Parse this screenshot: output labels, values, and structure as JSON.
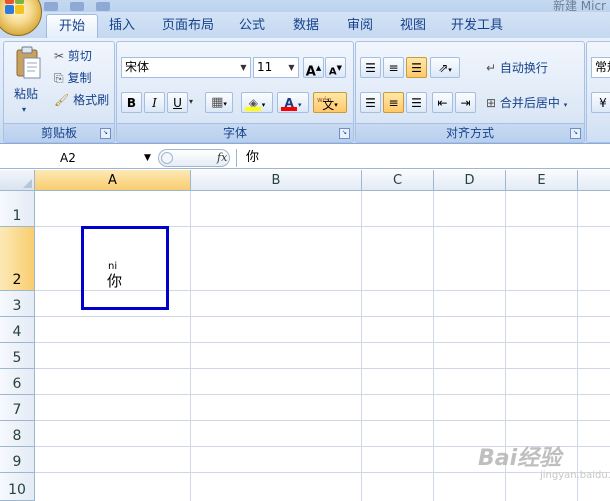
{
  "window": {
    "title_fragment": "新建 Micr"
  },
  "tabs": [
    {
      "label": "开始",
      "active": true
    },
    {
      "label": "插入"
    },
    {
      "label": "页面布局"
    },
    {
      "label": "公式"
    },
    {
      "label": "数据"
    },
    {
      "label": "审阅"
    },
    {
      "label": "视图"
    },
    {
      "label": "开发工具"
    }
  ],
  "ribbon": {
    "clipboard": {
      "label": "剪贴板",
      "paste": "粘贴",
      "cut": "剪切",
      "copy": "复制",
      "format_painter": "格式刷"
    },
    "font": {
      "label": "字体",
      "font_name": "宋体",
      "font_size": "11",
      "bold": "B",
      "italic": "I",
      "underline": "U",
      "grow": "A",
      "shrink": "A",
      "font_color_glyph": "A",
      "phonetic_glyph": "文",
      "phonetic_top": "wén"
    },
    "alignment": {
      "label": "对齐方式",
      "wrap_text": "自动换行",
      "merge_center": "合并后居中"
    },
    "number": {
      "format_fragment": "常规"
    }
  },
  "formula_bar": {
    "name_box": "A2",
    "fx": "fx",
    "content": "你"
  },
  "grid": {
    "columns": [
      "A",
      "B",
      "C",
      "D",
      "E"
    ],
    "selected_column": "A",
    "rows": [
      "1",
      "2",
      "3",
      "4",
      "5",
      "6",
      "7",
      "8",
      "9",
      "10"
    ],
    "selected_row": "2",
    "cell_A2": {
      "phonetic": "ni",
      "value": "你"
    }
  },
  "watermark": {
    "text": "Bai经验",
    "sub": "jingyan.baidu.com"
  },
  "colors": {
    "ribbon_text": "#15428b",
    "selection_border": "#0000cc",
    "header_selected": "#f8cd6e",
    "gridline": "#d0d7e5"
  }
}
